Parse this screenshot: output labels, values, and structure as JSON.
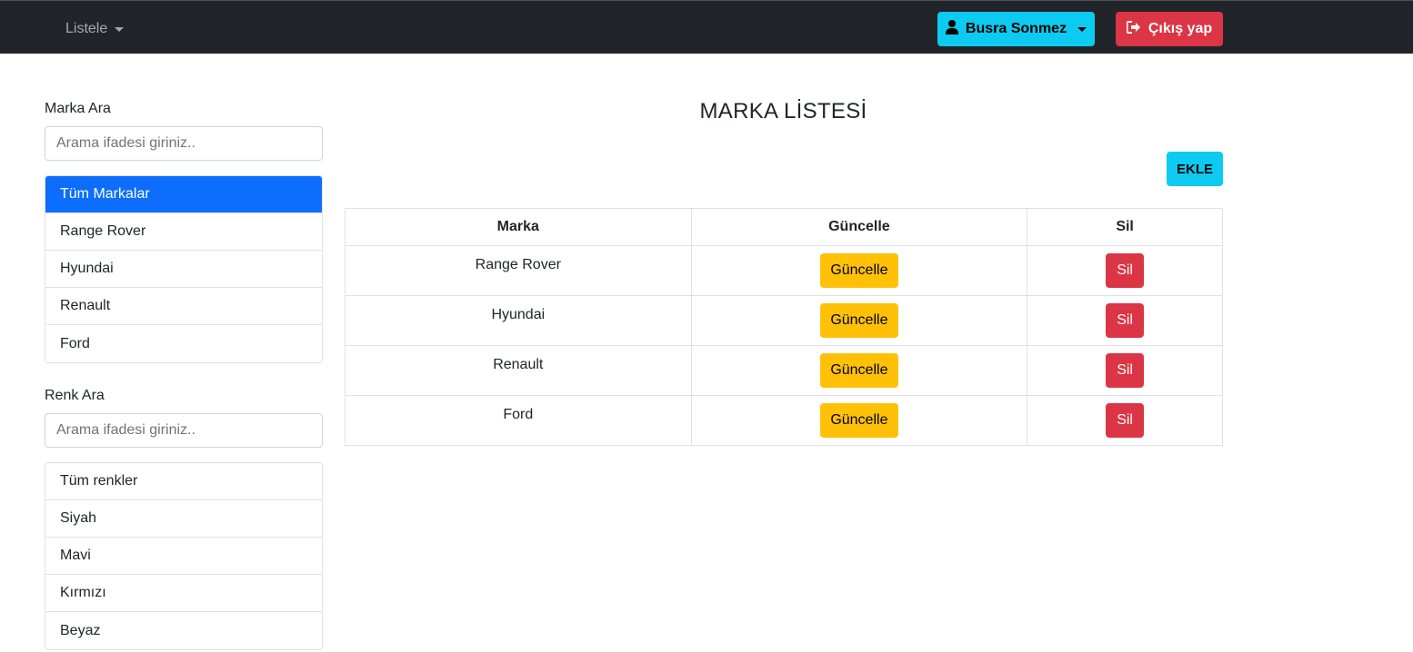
{
  "navbar": {
    "menu_label": "Listele",
    "user_label": "Busra Sonmez",
    "logout_label": "Çıkış yap"
  },
  "sidebar": {
    "brand_search": {
      "label": "Marka Ara",
      "placeholder": "Arama ifadesi giriniz.."
    },
    "brands": [
      {
        "label": "Tüm Markalar",
        "active": true
      },
      {
        "label": "Range Rover"
      },
      {
        "label": "Hyundai"
      },
      {
        "label": "Renault"
      },
      {
        "label": "Ford"
      }
    ],
    "color_search": {
      "label": "Renk Ara",
      "placeholder": "Arama ifadesi giriniz.."
    },
    "colors": [
      {
        "label": "Tüm renkler"
      },
      {
        "label": "Siyah"
      },
      {
        "label": "Mavi"
      },
      {
        "label": "Kırmızı"
      },
      {
        "label": "Beyaz"
      }
    ]
  },
  "main": {
    "title": "MARKA LİSTESİ",
    "add_label": "EKLE",
    "table": {
      "headers": [
        "Marka",
        "Güncelle",
        "Sil"
      ],
      "update_label": "Güncelle",
      "delete_label": "Sil",
      "rows": [
        {
          "brand": "Range Rover"
        },
        {
          "brand": "Hyundai"
        },
        {
          "brand": "Renault"
        },
        {
          "brand": "Ford"
        }
      ]
    }
  },
  "colors": {
    "navbar_bg": "#212529",
    "primary": "#0d6efd",
    "info": "#0dcaf0",
    "danger": "#dc3545",
    "warning": "#ffc107"
  },
  "icons": {
    "user": "user-icon",
    "logout": "sign-out-icon"
  }
}
